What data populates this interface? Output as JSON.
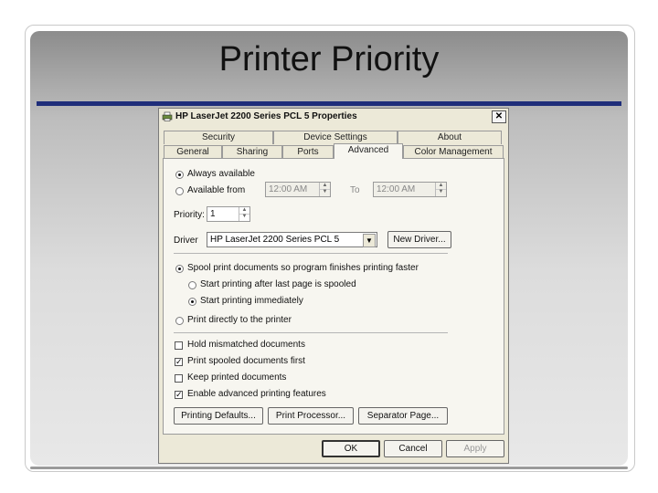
{
  "slide": {
    "title": "Printer Priority"
  },
  "dialog": {
    "title": "HP LaserJet 2200 Series PCL 5 Properties",
    "close_label": "✕",
    "tabs_back": [
      "Security",
      "Device Settings",
      "About"
    ],
    "tabs_front": [
      "General",
      "Sharing",
      "Ports",
      "Advanced",
      "Color Management"
    ],
    "active_tab": "Advanced",
    "availability": {
      "always_label": "Always available",
      "from_label": "Available from",
      "selected": "always",
      "from_time": "12:00 AM",
      "to_label": "To",
      "to_time": "12:00 AM"
    },
    "priority": {
      "label": "Priority:",
      "value": "1"
    },
    "driver": {
      "label": "Driver",
      "value": "HP LaserJet 2200 Series PCL 5",
      "new_driver_label": "New Driver..."
    },
    "spooling": {
      "spool_label": "Spool print documents so program finishes printing faster",
      "after_last_label": "Start printing after last page is spooled",
      "immediately_label": "Start printing immediately",
      "direct_label": "Print directly to the printer"
    },
    "options": [
      {
        "label": "Hold mismatched documents",
        "checked": false
      },
      {
        "label": "Print spooled documents first",
        "checked": true
      },
      {
        "label": "Keep printed documents",
        "checked": false
      },
      {
        "label": "Enable advanced printing features",
        "checked": true
      }
    ],
    "buttons": {
      "printing_defaults": "Printing Defaults...",
      "print_processor": "Print Processor...",
      "separator_page": "Separator Page...",
      "ok": "OK",
      "cancel": "Cancel",
      "apply": "Apply"
    }
  }
}
